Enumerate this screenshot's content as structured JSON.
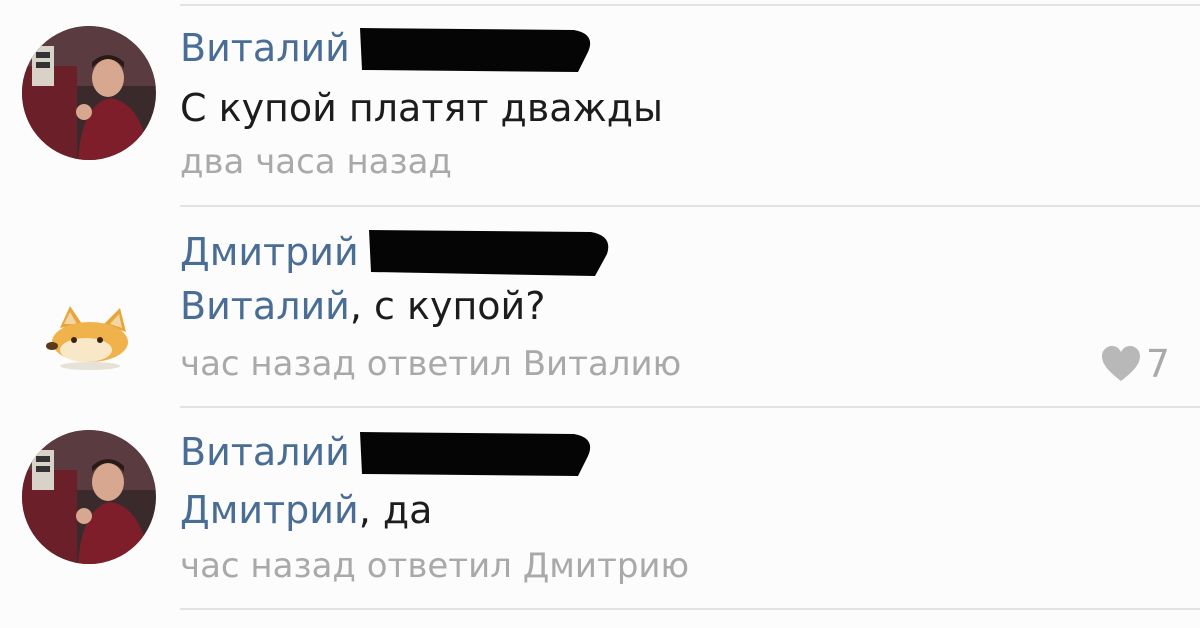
{
  "comments": [
    {
      "author": "Виталий",
      "text": "С купой платят дважды",
      "meta": "два часа назад"
    },
    {
      "author": "Дмитрий",
      "mention": "Виталий",
      "text_rest": ", с купой?",
      "meta": "час назад ответил Виталию",
      "likes": "7",
      "like_icon": "heart-icon"
    },
    {
      "author": "Виталий",
      "mention": "Дмитрий",
      "text_rest": ", да",
      "meta": "час назад ответил Дмитрию"
    }
  ],
  "colors": {
    "author": "#4a6d96",
    "text": "#1c1c1c",
    "meta": "#a9a9a9",
    "divider": "#e3e3e3"
  }
}
